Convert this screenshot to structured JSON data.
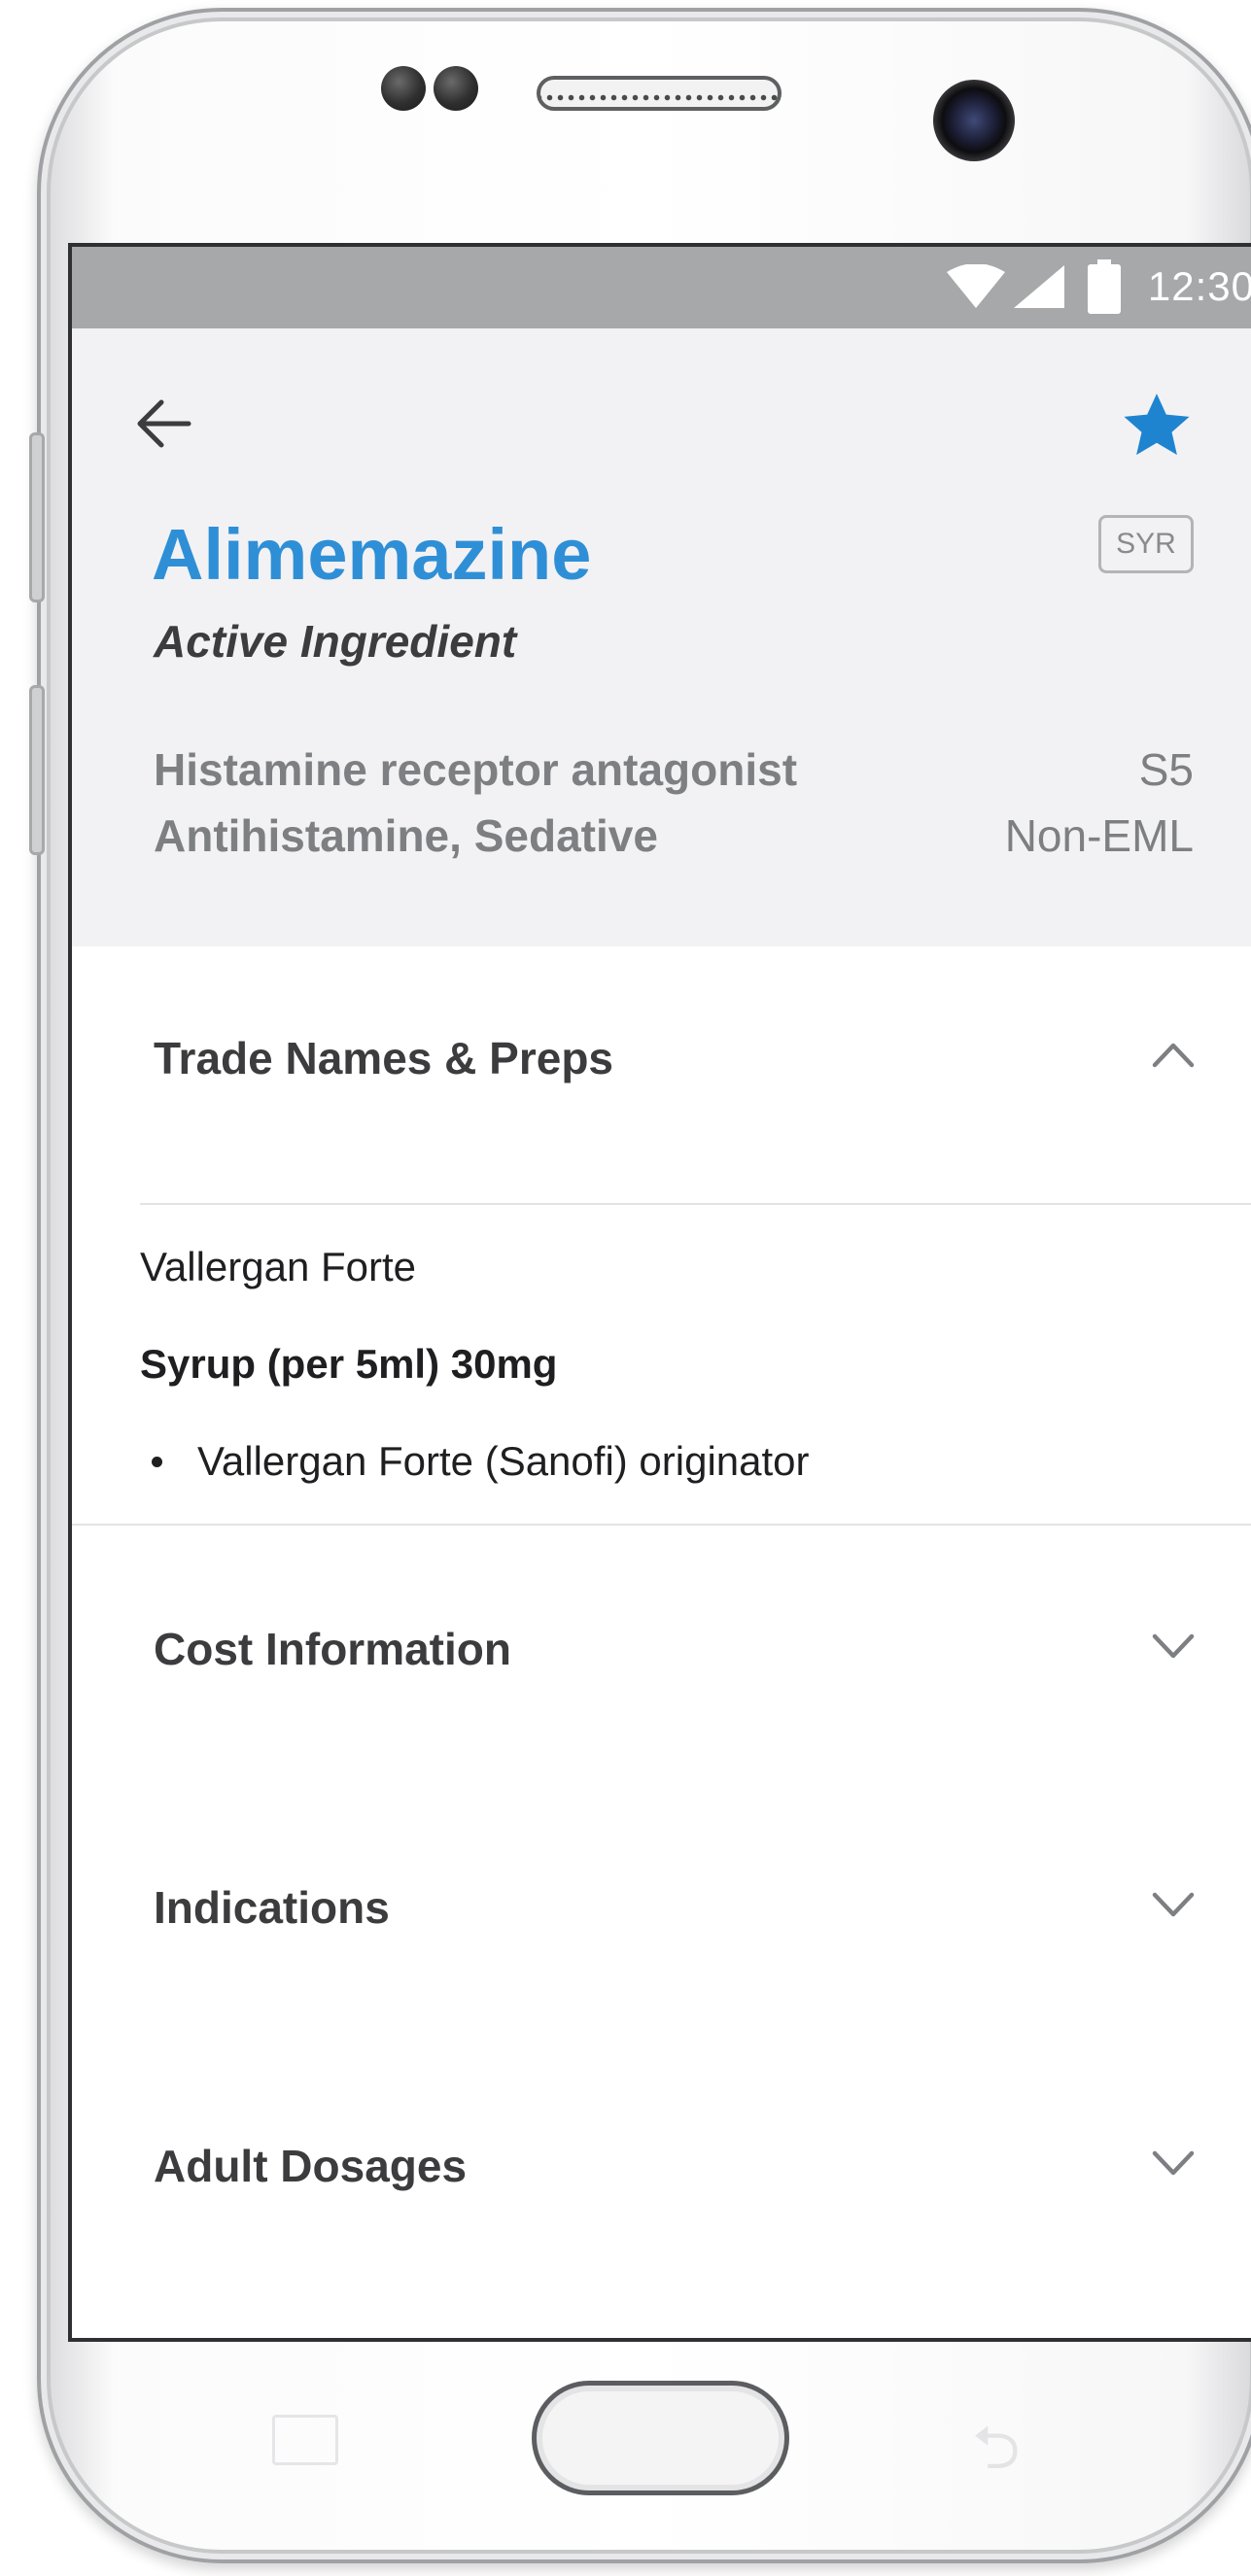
{
  "status_bar": {
    "time": "12:30"
  },
  "drug": {
    "name": "Alimemazine",
    "type": "Active Ingredient",
    "form_badge": "SYR",
    "class_primary": "Histamine receptor antagonist",
    "schedule": "S5",
    "class_secondary": "Antihistamine, Sedative",
    "eml_status": "Non-EML"
  },
  "sections": {
    "trade_names": {
      "title": "Trade Names & Preps",
      "expanded": true,
      "trade_name": "Vallergan Forte",
      "preparation": "Syrup (per 5ml) 30mg",
      "items": [
        "Vallergan Forte (Sanofi) originator"
      ]
    },
    "cost": {
      "title": "Cost Information"
    },
    "indications": {
      "title": "Indications"
    },
    "adult_dosages": {
      "title": "Adult Dosages"
    }
  },
  "icons": {
    "back": "arrow-left-icon",
    "favorite": "star-icon",
    "collapse": "chevron-up-icon",
    "expand": "chevron-down-icon",
    "wifi": "wifi-icon",
    "signal": "signal-icon",
    "battery": "battery-icon"
  },
  "colors": {
    "accent": "#2f8fd6",
    "header_bg": "#f2f2f4",
    "status_bar": "#a6a8aa",
    "star": "#1f84d0"
  }
}
